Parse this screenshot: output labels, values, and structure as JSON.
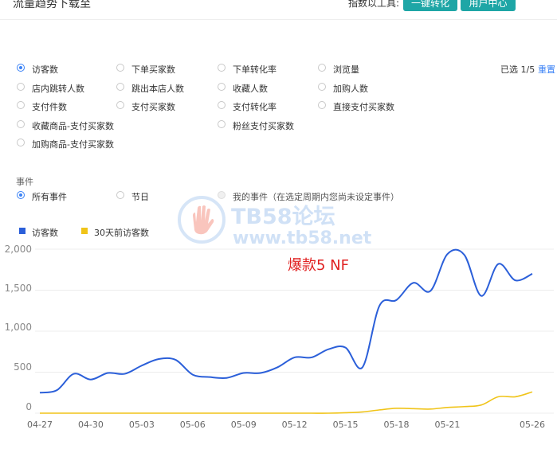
{
  "header": {
    "title": "流量趋势下载至",
    "tools_label": "指数以工具:",
    "convert_button": "一键转化",
    "user_center_button": "用户中心"
  },
  "metrics": {
    "selected_count": "已选 1/5",
    "reset_label": "重置",
    "options": [
      {
        "label": "访客数",
        "checked": true
      },
      {
        "label": "下单买家数",
        "checked": false
      },
      {
        "label": "下单转化率",
        "checked": false
      },
      {
        "label": "浏览量",
        "checked": false
      },
      {
        "label": "店内跳转人数",
        "checked": false
      },
      {
        "label": "跳出本店人数",
        "checked": false
      },
      {
        "label": "收藏人数",
        "checked": false
      },
      {
        "label": "加购人数",
        "checked": false
      },
      {
        "label": "支付件数",
        "checked": false
      },
      {
        "label": "支付买家数",
        "checked": false
      },
      {
        "label": "支付转化率",
        "checked": false
      },
      {
        "label": "直接支付买家数",
        "checked": false
      },
      {
        "label": "收藏商品-支付买家数",
        "checked": false
      },
      {
        "label": "粉丝支付买家数",
        "checked": false
      },
      {
        "label": "加购商品-支付买家数",
        "checked": false
      }
    ]
  },
  "events": {
    "title": "事件",
    "options": [
      {
        "label": "所有事件",
        "checked": true
      },
      {
        "label": "节日",
        "checked": false
      },
      {
        "label": "我的事件（在选定周期内您尚未设定事件）",
        "checked": false,
        "disabled": true
      }
    ]
  },
  "watermark": {
    "line1": "TB58论坛",
    "line2": "www.tb58.net"
  },
  "annotation": "爆款5 NF",
  "colors": {
    "series_blue": "#2b5fd9",
    "series_yellow": "#f0c419",
    "accent": "#1ea6a6"
  },
  "chart_data": {
    "type": "line",
    "ylim": [
      0,
      2000
    ],
    "yticks": [
      "2,000",
      "1,500",
      "1,000",
      "500",
      "0"
    ],
    "categories": [
      "04-27",
      "04-28",
      "04-29",
      "04-30",
      "05-01",
      "05-02",
      "05-03",
      "05-04",
      "05-05",
      "05-06",
      "05-07",
      "05-08",
      "05-09",
      "05-10",
      "05-11",
      "05-12",
      "05-13",
      "05-14",
      "05-15",
      "05-16",
      "05-17",
      "05-18",
      "05-19",
      "05-20",
      "05-21",
      "05-22",
      "05-23",
      "05-24",
      "05-25",
      "05-26"
    ],
    "xtick_labels": [
      "04-27",
      "04-30",
      "05-03",
      "05-06",
      "05-09",
      "05-12",
      "05-15",
      "05-18",
      "05-21",
      "05-26"
    ],
    "series": [
      {
        "name": "访客数",
        "color": "#2b5fd9",
        "values": [
          250,
          280,
          480,
          410,
          490,
          480,
          580,
          660,
          650,
          470,
          440,
          430,
          490,
          490,
          560,
          680,
          680,
          780,
          800,
          560,
          1310,
          1380,
          1590,
          1490,
          1940,
          1930,
          1430,
          1820,
          1620,
          1700
        ]
      },
      {
        "name": "30天前访客数",
        "color": "#f0c419",
        "values": [
          0,
          0,
          0,
          0,
          0,
          0,
          0,
          0,
          0,
          0,
          0,
          0,
          0,
          0,
          0,
          0,
          0,
          0,
          5,
          15,
          40,
          60,
          55,
          50,
          70,
          80,
          100,
          200,
          200,
          260
        ]
      }
    ]
  }
}
